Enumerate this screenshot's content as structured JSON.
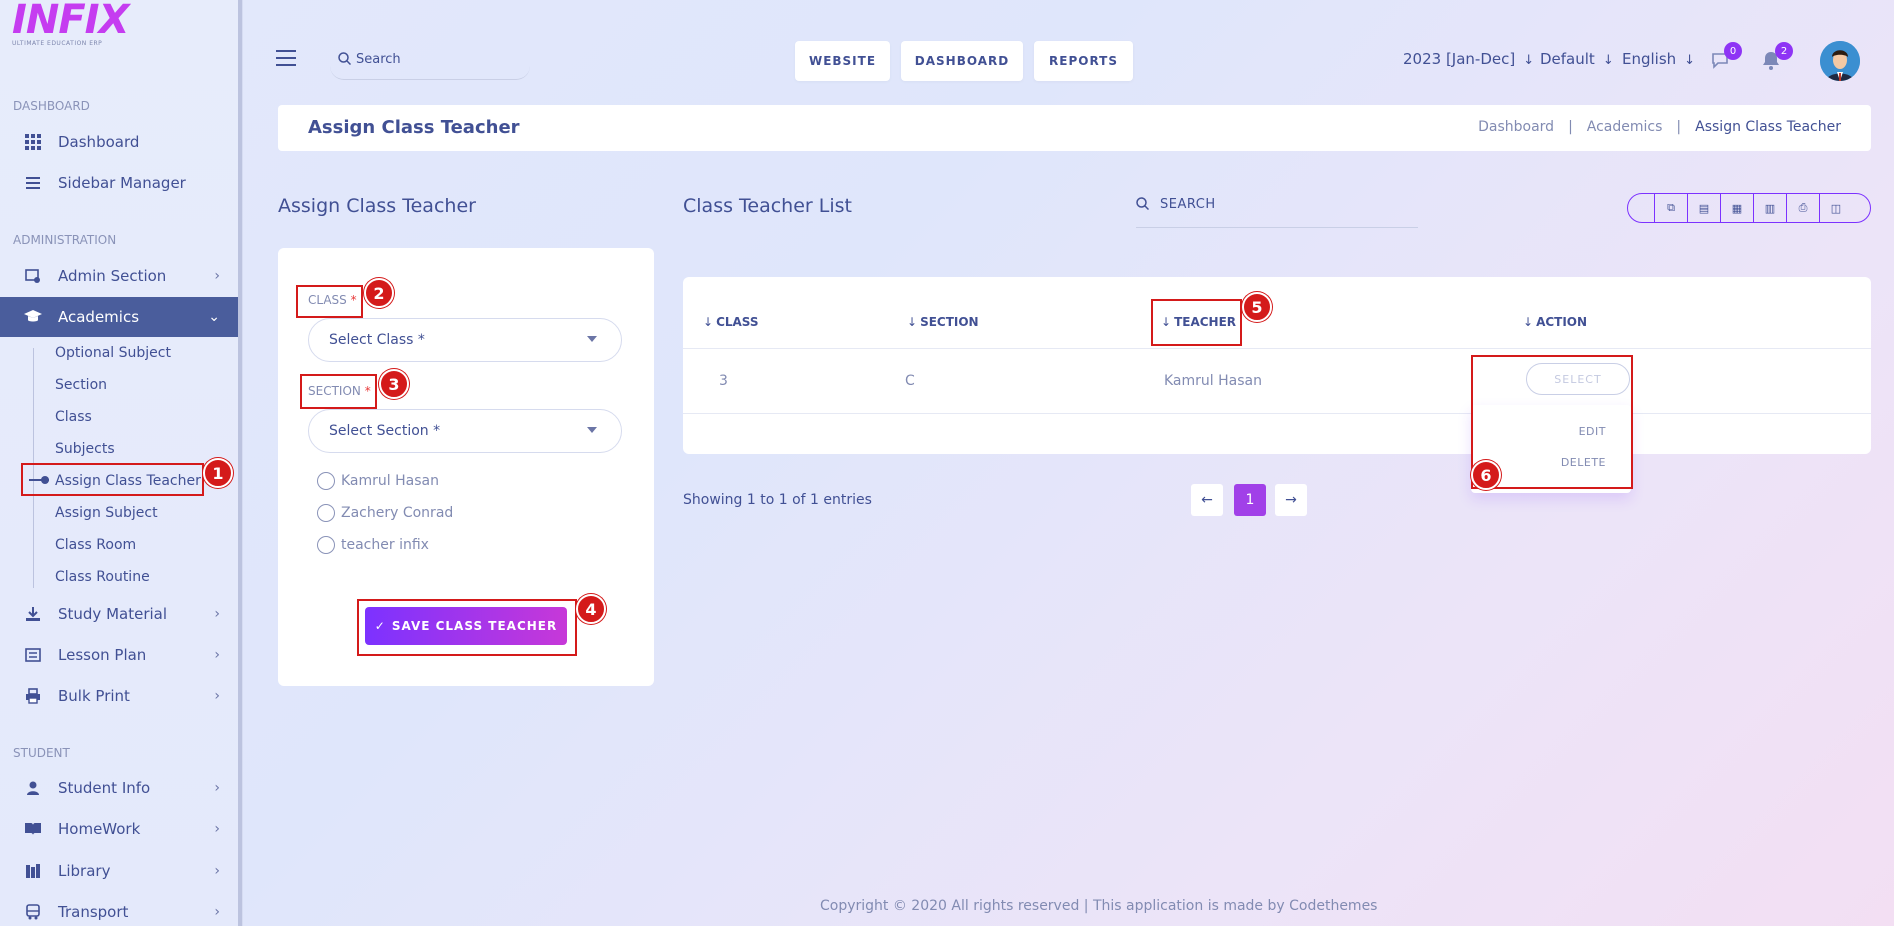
{
  "logo": {
    "text": "INFIX",
    "tagline": "ULTIMATE EDUCATION ERP"
  },
  "sidebar": {
    "sections": [
      "DASHBOARD",
      "ADMINISTRATION",
      "STUDENT"
    ],
    "dashboard_items": [
      "Dashboard",
      "Sidebar Manager"
    ],
    "admin_items": [
      {
        "label": "Admin Section",
        "icon": "admin-icon"
      },
      {
        "label": "Academics",
        "icon": "graduation-cap-icon"
      }
    ],
    "academics_sub": [
      "Optional Subject",
      "Section",
      "Class",
      "Subjects",
      "Assign Class Teacher",
      "Assign Subject",
      "Class Room",
      "Class Routine"
    ],
    "more_items": [
      "Study Material",
      "Lesson Plan",
      "Bulk Print"
    ],
    "student_items": [
      "Student Info",
      "HomeWork",
      "Library",
      "Transport"
    ]
  },
  "topbar": {
    "search_placeholder": "Search",
    "buttons": [
      "WEBSITE",
      "DASHBOARD",
      "REPORTS"
    ],
    "session": "2023 [Jan-Dec]",
    "style": "Default",
    "language": "English",
    "messages_count": "0",
    "notifications_count": "2"
  },
  "page": {
    "title": "Assign Class Teacher",
    "breadcrumb": [
      "Dashboard",
      "Academics",
      "Assign Class Teacher"
    ],
    "separator": "|"
  },
  "form": {
    "title": "Assign Class Teacher",
    "class_label": "CLASS",
    "class_placeholder": "Select Class *",
    "section_label": "SECTION",
    "section_placeholder": "Select Section *",
    "required_mark": "*",
    "teachers": [
      "Kamrul Hasan",
      "Zachery Conrad",
      "teacher infix"
    ],
    "save_label": "SAVE CLASS TEACHER"
  },
  "list": {
    "title": "Class Teacher List",
    "search_placeholder": "SEARCH",
    "columns": [
      "CLASS",
      "SECTION",
      "TEACHER",
      "ACTION"
    ],
    "rows": [
      {
        "class": "3",
        "section": "C",
        "teacher": "Kamrul Hasan",
        "action": "SELECT"
      }
    ],
    "dropdown": [
      "EDIT",
      "DELETE"
    ],
    "showing": "Showing 1 to 1 of 1 entries",
    "current_page": "1"
  },
  "footer": "Copyright © 2020 All rights reserved | This application is made by Codethemes",
  "annotations": [
    "1",
    "2",
    "3",
    "4",
    "5",
    "6"
  ],
  "colors": {
    "accent": "#7c32ff",
    "accent2": "#c738d8",
    "active_bg": "#4a5d9c",
    "text": "#415094",
    "highlight": "#d41a1a"
  }
}
